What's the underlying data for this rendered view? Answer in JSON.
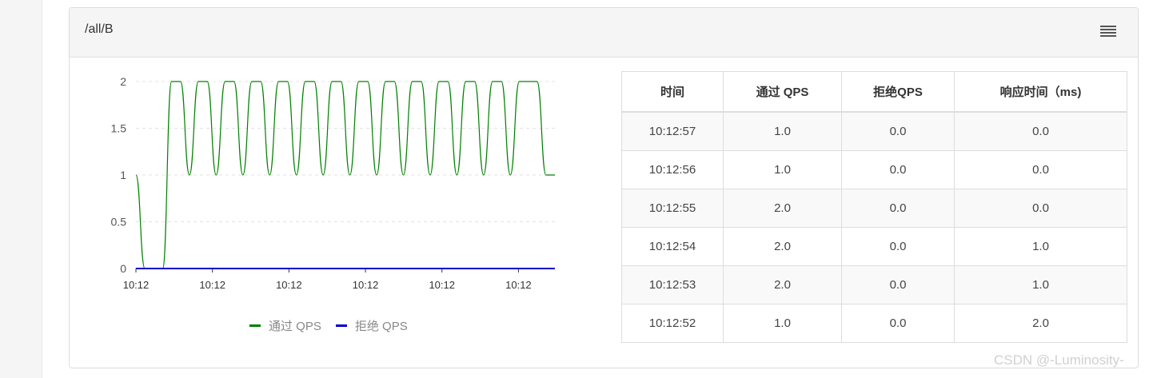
{
  "panel": {
    "title": "/all/B",
    "menu_icon": "hamburger-menu-icon"
  },
  "chart_data": {
    "type": "line",
    "x_tick_labels": [
      "10:12",
      "10:12",
      "10:12",
      "10:12",
      "10:12",
      "10:12"
    ],
    "y_ticks": [
      "2",
      "1.5",
      "1",
      "0.5",
      "0"
    ],
    "ylim": [
      0,
      2
    ],
    "grid": true,
    "legend_position": "bottom",
    "series": [
      {
        "name": "通过 QPS",
        "color": "#008000",
        "values": [
          1,
          0,
          0,
          0,
          2,
          2,
          1,
          2,
          2,
          1,
          2,
          2,
          1,
          2,
          2,
          1,
          2,
          2,
          1,
          2,
          2,
          1,
          2,
          2,
          1,
          2,
          2,
          1,
          2,
          2,
          1,
          2,
          2,
          1,
          2,
          2,
          1,
          2,
          2,
          1,
          2,
          2,
          1,
          2,
          2,
          2,
          1,
          1
        ]
      },
      {
        "name": "拒绝 QPS",
        "color": "#0000cc",
        "values": [
          0,
          0
        ]
      }
    ]
  },
  "table": {
    "headers": [
      "时间",
      "通过 QPS",
      "拒绝QPS",
      "响应时间（ms)"
    ],
    "rows": [
      [
        "10:12:57",
        "1.0",
        "0.0",
        "0.0"
      ],
      [
        "10:12:56",
        "1.0",
        "0.0",
        "0.0"
      ],
      [
        "10:12:55",
        "2.0",
        "0.0",
        "0.0"
      ],
      [
        "10:12:54",
        "2.0",
        "0.0",
        "1.0"
      ],
      [
        "10:12:53",
        "2.0",
        "0.0",
        "1.0"
      ],
      [
        "10:12:52",
        "1.0",
        "0.0",
        "2.0"
      ]
    ]
  },
  "watermark": "CSDN @-Luminosity-"
}
